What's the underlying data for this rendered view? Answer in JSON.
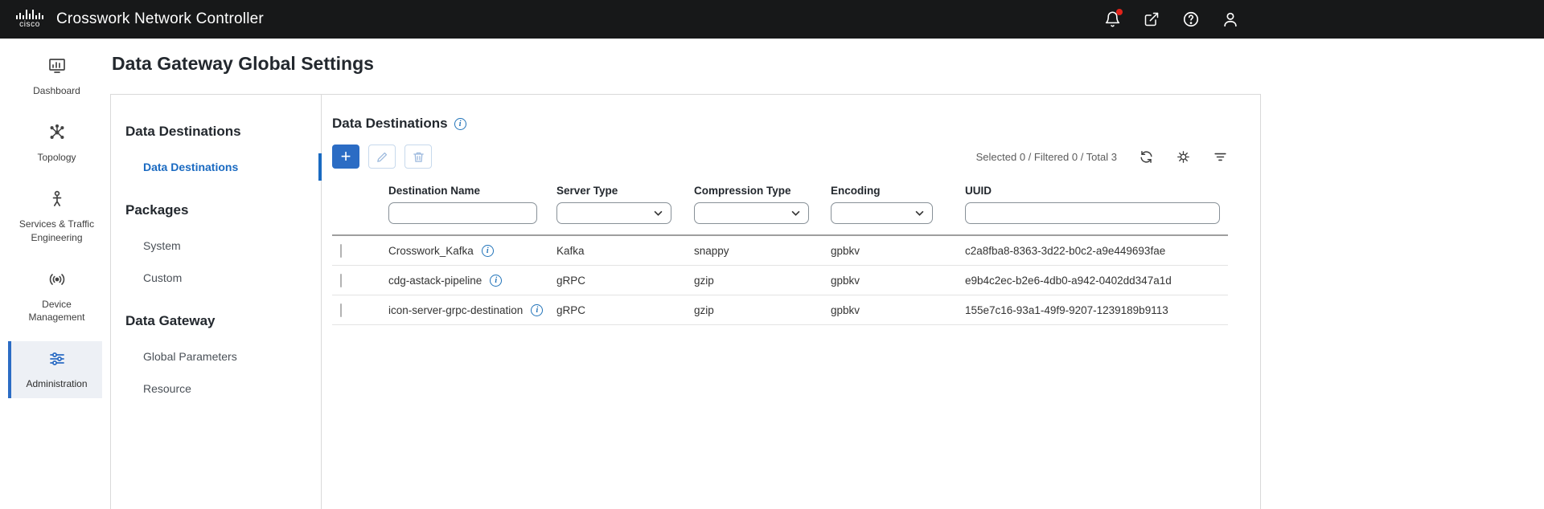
{
  "topbar": {
    "logo_text": "cisco",
    "app_title": "Crosswork Network Controller"
  },
  "sidebar": {
    "items": [
      {
        "label": "Dashboard",
        "icon": "dashboard-icon",
        "active": false
      },
      {
        "label": "Topology",
        "icon": "topology-icon",
        "active": false
      },
      {
        "label": "Services & Traffic Engineering",
        "icon": "services-traffic-icon",
        "active": false
      },
      {
        "label": "Device Management",
        "icon": "device-management-icon",
        "active": false
      },
      {
        "label": "Administration",
        "icon": "administration-icon",
        "active": true
      }
    ]
  },
  "page": {
    "title": "Data Gateway Global Settings"
  },
  "subnav": {
    "sections": [
      {
        "header": "Data Destinations",
        "items": [
          {
            "label": "Data Destinations",
            "active": true
          }
        ]
      },
      {
        "header": "Packages",
        "items": [
          {
            "label": "System",
            "active": false
          },
          {
            "label": "Custom",
            "active": false
          }
        ]
      },
      {
        "header": "Data Gateway",
        "items": [
          {
            "label": "Global Parameters",
            "active": false
          },
          {
            "label": "Resource",
            "active": false
          }
        ]
      }
    ]
  },
  "content": {
    "heading": "Data Destinations",
    "toolbar": {
      "add_label": "+",
      "summary": "Selected 0 / Filtered 0 / Total 3",
      "icons": [
        "add-icon",
        "edit-pencil-icon",
        "delete-trash-icon",
        "refresh-icon",
        "gear-icon",
        "filter-icon"
      ]
    },
    "table": {
      "columns": [
        "Destination Name",
        "Server Type",
        "Compression Type",
        "Encoding",
        "UUID"
      ],
      "rows": [
        {
          "name": "Crosswork_Kafka",
          "server_type": "Kafka",
          "compression_type": "snappy",
          "encoding": "gpbkv",
          "uuid": "c2a8fba8-8363-3d22-b0c2-a9e449693fae"
        },
        {
          "name": "cdg-astack-pipeline",
          "server_type": "gRPC",
          "compression_type": "gzip",
          "encoding": "gpbkv",
          "uuid": "e9b4c2ec-b2e6-4db0-a942-0402dd347a1d"
        },
        {
          "name": "icon-server-grpc-destination",
          "server_type": "gRPC",
          "compression_type": "gzip",
          "encoding": "gpbkv",
          "uuid": "155e7c16-93a1-49f9-9207-1239189b9113"
        }
      ]
    }
  },
  "colors": {
    "accent_blue": "#2b6cc4",
    "link_blue": "#1a6ac1",
    "alert_red": "#e2231a",
    "topbar_bg": "#171819"
  }
}
